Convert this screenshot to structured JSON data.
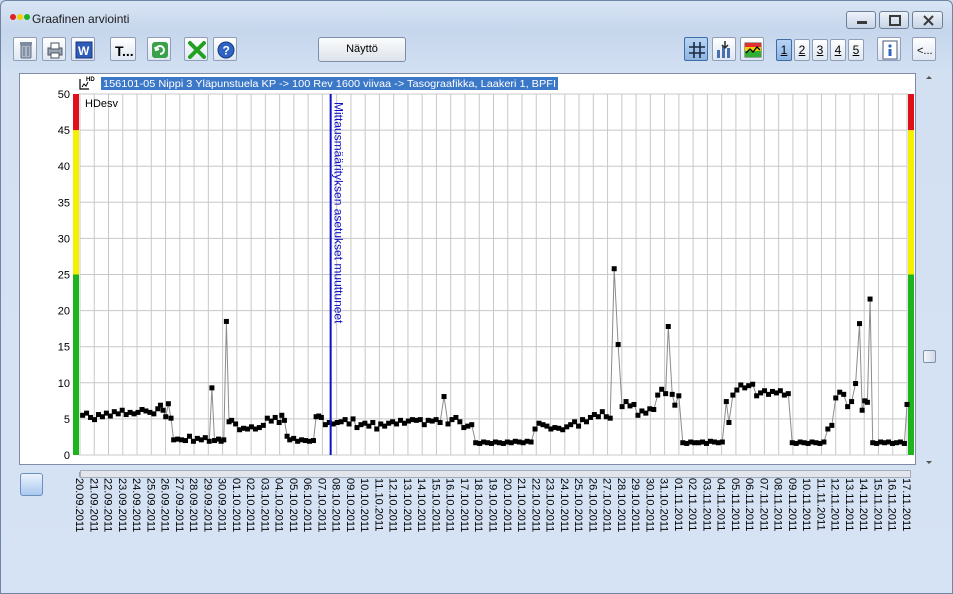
{
  "window": {
    "title": "Graafinen arviointi"
  },
  "toolbar": {
    "naytto_label": "Näyttö",
    "text_tool_label": "T...",
    "left_buttons": [
      "trash-icon",
      "printer-icon",
      "word-export-icon",
      "text-tool-icon",
      "refresh-icon",
      "cancel-icon",
      "help-icon"
    ],
    "right_buttons": [
      "grid-icon",
      "chart-export-icon",
      "chart-view-icon"
    ],
    "page_numbers": [
      "1",
      "2",
      "3",
      "4",
      "5"
    ],
    "selected_page": "1",
    "back_label": "<..."
  },
  "plot": {
    "header_label": "156101-05 Nippi 3 Yläpunstuela KP -> 100 Rev 1600 viivaa -> Tasograafikka, Laakeri 1, BPFI",
    "hd_badge": "HD",
    "series_label": "HDesv",
    "annotation_text": "Mittausmäärityksen asetukset muuttuneet",
    "colors": {
      "line": "#8c8c8c",
      "marker": "#000000",
      "annotation": "#1010c8",
      "zone_green": "#1db41d",
      "zone_yellow": "#f4f000",
      "zone_red": "#e0101a",
      "header_bg": "#3c78c8"
    }
  },
  "chart_data": {
    "type": "scatter",
    "ylim": [
      0,
      50
    ],
    "yticks": [
      0,
      5,
      10,
      15,
      20,
      25,
      30,
      35,
      40,
      45,
      50
    ],
    "grid": true,
    "zones": [
      {
        "from": 0,
        "to": 25,
        "color": "green"
      },
      {
        "from": 25,
        "to": 45,
        "color": "yellow"
      },
      {
        "from": 45,
        "to": 50,
        "color": "red"
      }
    ],
    "x_range_days": [
      0,
      57
    ],
    "annotation_day": 18,
    "xtick_labels": [
      "20.09.2011",
      "21.09.2011",
      "22.09.2011",
      "23.09.2011",
      "24.09.2011",
      "25.09.2011",
      "26.09.2011",
      "27.09.2011",
      "28.09.2011",
      "29.09.2011",
      "30.09.2011",
      "01.10.2011",
      "02.10.2011",
      "03.10.2011",
      "04.10.2011",
      "05.10.2011",
      "06.10.2011",
      "07.10.2011",
      "08.10.2011",
      "09.10.2011",
      "10.10.2011",
      "11.10.2011",
      "12.10.2011",
      "13.10.2011",
      "14.10.2011",
      "15.10.2011",
      "16.10.2011",
      "17.10.2011",
      "18.10.2011",
      "19.10.2011",
      "20.10.2011",
      "21.10.2011",
      "22.10.2011",
      "23.10.2011",
      "24.10.2011",
      "25.10.2011",
      "26.10.2011",
      "27.10.2011",
      "28.10.2011",
      "29.10.2011",
      "30.10.2011",
      "31.10.2011",
      "01.11.2011",
      "02.11.2011",
      "03.11.2011",
      "04.11.2011",
      "05.11.2011",
      "06.11.2011",
      "07.11.2011",
      "08.11.2011",
      "09.11.2011",
      "10.11.2011",
      "11.11.2011",
      "12.11.2011",
      "13.11.2011",
      "14.11.2011",
      "15.11.2011",
      "16.11.2011",
      "17.11.2011"
    ],
    "points": [
      [
        0.2,
        5.5
      ],
      [
        0.5,
        5.8
      ],
      [
        0.8,
        5.2
      ],
      [
        1.1,
        4.9
      ],
      [
        1.4,
        5.6
      ],
      [
        1.7,
        5.3
      ],
      [
        2.0,
        5.8
      ],
      [
        2.3,
        5.4
      ],
      [
        2.6,
        6.0
      ],
      [
        2.9,
        5.7
      ],
      [
        3.2,
        6.2
      ],
      [
        3.5,
        5.6
      ],
      [
        3.8,
        5.9
      ],
      [
        4.1,
        5.7
      ],
      [
        4.4,
        5.9
      ],
      [
        4.7,
        6.3
      ],
      [
        5.0,
        6.1
      ],
      [
        5.3,
        5.9
      ],
      [
        5.6,
        5.7
      ],
      [
        5.9,
        6.4
      ],
      [
        6.1,
        6.9
      ],
      [
        6.3,
        6.2
      ],
      [
        6.5,
        5.3
      ],
      [
        6.7,
        7.1
      ],
      [
        6.9,
        5.1
      ],
      [
        7.1,
        2.1
      ],
      [
        7.4,
        2.2
      ],
      [
        7.7,
        2.1
      ],
      [
        8.0,
        2.0
      ],
      [
        8.3,
        2.6
      ],
      [
        8.6,
        1.9
      ],
      [
        8.9,
        2.3
      ],
      [
        9.2,
        2.1
      ],
      [
        9.5,
        2.4
      ],
      [
        9.8,
        1.9
      ],
      [
        10.0,
        9.3
      ],
      [
        10.2,
        2.0
      ],
      [
        10.5,
        2.2
      ],
      [
        10.7,
        1.9
      ],
      [
        10.9,
        2.1
      ],
      [
        11.1,
        18.5
      ],
      [
        11.3,
        4.6
      ],
      [
        11.5,
        4.8
      ],
      [
        11.8,
        4.3
      ],
      [
        12.1,
        3.5
      ],
      [
        12.4,
        3.7
      ],
      [
        12.7,
        3.6
      ],
      [
        13.0,
        3.9
      ],
      [
        13.3,
        3.6
      ],
      [
        13.6,
        3.8
      ],
      [
        13.9,
        4.1
      ],
      [
        14.2,
        5.1
      ],
      [
        14.5,
        4.7
      ],
      [
        14.8,
        5.2
      ],
      [
        15.1,
        4.5
      ],
      [
        15.3,
        5.5
      ],
      [
        15.5,
        4.8
      ],
      [
        15.7,
        2.6
      ],
      [
        15.9,
        2.1
      ],
      [
        16.2,
        2.3
      ],
      [
        16.5,
        1.9
      ],
      [
        16.8,
        2.1
      ],
      [
        17.1,
        2.0
      ],
      [
        17.4,
        1.9
      ],
      [
        17.7,
        2.0
      ],
      [
        17.9,
        5.3
      ],
      [
        18.1,
        5.4
      ],
      [
        18.3,
        5.2
      ],
      [
        18.6,
        4.2
      ],
      [
        18.9,
        4.5
      ],
      [
        19.2,
        4.3
      ],
      [
        19.5,
        4.5
      ],
      [
        19.8,
        4.6
      ],
      [
        20.1,
        4.9
      ],
      [
        20.4,
        4.3
      ],
      [
        20.7,
        5.0
      ],
      [
        21.0,
        3.8
      ],
      [
        21.3,
        4.2
      ],
      [
        21.6,
        4.4
      ],
      [
        21.9,
        4.0
      ],
      [
        22.2,
        4.5
      ],
      [
        22.5,
        3.6
      ],
      [
        22.8,
        4.3
      ],
      [
        23.1,
        4.0
      ],
      [
        23.4,
        4.4
      ],
      [
        23.7,
        4.6
      ],
      [
        24.0,
        4.3
      ],
      [
        24.3,
        4.8
      ],
      [
        24.6,
        4.4
      ],
      [
        24.9,
        4.7
      ],
      [
        25.2,
        4.9
      ],
      [
        25.5,
        4.8
      ],
      [
        25.8,
        4.9
      ],
      [
        26.1,
        4.2
      ],
      [
        26.4,
        4.8
      ],
      [
        26.7,
        4.7
      ],
      [
        27.0,
        4.9
      ],
      [
        27.3,
        4.5
      ],
      [
        27.6,
        8.1
      ],
      [
        27.9,
        4.3
      ],
      [
        28.2,
        4.9
      ],
      [
        28.5,
        5.2
      ],
      [
        28.8,
        4.6
      ],
      [
        29.1,
        3.8
      ],
      [
        29.4,
        4.0
      ],
      [
        29.7,
        4.2
      ],
      [
        30.0,
        1.7
      ],
      [
        30.3,
        1.6
      ],
      [
        30.6,
        1.8
      ],
      [
        30.9,
        1.7
      ],
      [
        31.2,
        1.6
      ],
      [
        31.5,
        1.8
      ],
      [
        31.8,
        1.7
      ],
      [
        32.1,
        1.6
      ],
      [
        32.4,
        1.8
      ],
      [
        32.7,
        1.7
      ],
      [
        33.0,
        1.9
      ],
      [
        33.3,
        1.8
      ],
      [
        33.6,
        1.7
      ],
      [
        33.9,
        1.9
      ],
      [
        34.2,
        1.8
      ],
      [
        34.5,
        3.6
      ],
      [
        34.8,
        4.4
      ],
      [
        35.1,
        4.2
      ],
      [
        35.4,
        4.0
      ],
      [
        35.7,
        3.6
      ],
      [
        36.0,
        3.8
      ],
      [
        36.3,
        3.7
      ],
      [
        36.6,
        3.5
      ],
      [
        36.9,
        3.9
      ],
      [
        37.2,
        4.2
      ],
      [
        37.5,
        4.6
      ],
      [
        37.8,
        4.0
      ],
      [
        38.1,
        4.9
      ],
      [
        38.4,
        4.6
      ],
      [
        38.7,
        5.2
      ],
      [
        39.0,
        5.6
      ],
      [
        39.3,
        5.3
      ],
      [
        39.6,
        6.0
      ],
      [
        39.9,
        5.3
      ],
      [
        40.2,
        5.1
      ],
      [
        40.5,
        25.8
      ],
      [
        40.8,
        15.3
      ],
      [
        41.1,
        6.7
      ],
      [
        41.4,
        7.4
      ],
      [
        41.7,
        6.8
      ],
      [
        42.0,
        7.0
      ],
      [
        42.3,
        5.5
      ],
      [
        42.6,
        6.1
      ],
      [
        42.9,
        5.8
      ],
      [
        43.2,
        6.4
      ],
      [
        43.5,
        6.3
      ],
      [
        43.8,
        8.3
      ],
      [
        44.1,
        9.1
      ],
      [
        44.4,
        8.5
      ],
      [
        44.6,
        17.8
      ],
      [
        44.9,
        8.4
      ],
      [
        45.1,
        6.9
      ],
      [
        45.4,
        8.2
      ],
      [
        45.7,
        1.7
      ],
      [
        46.0,
        1.6
      ],
      [
        46.3,
        1.8
      ],
      [
        46.6,
        1.7
      ],
      [
        46.9,
        1.7
      ],
      [
        47.2,
        1.8
      ],
      [
        47.5,
        1.6
      ],
      [
        47.8,
        1.9
      ],
      [
        48.1,
        1.8
      ],
      [
        48.4,
        1.7
      ],
      [
        48.7,
        1.8
      ],
      [
        49.0,
        7.4
      ],
      [
        49.2,
        4.5
      ],
      [
        49.5,
        8.3
      ],
      [
        49.8,
        9.0
      ],
      [
        50.1,
        9.7
      ],
      [
        50.4,
        9.3
      ],
      [
        50.7,
        9.6
      ],
      [
        51.0,
        9.8
      ],
      [
        51.3,
        8.2
      ],
      [
        51.6,
        8.6
      ],
      [
        51.9,
        8.9
      ],
      [
        52.2,
        8.4
      ],
      [
        52.5,
        8.8
      ],
      [
        52.8,
        8.6
      ],
      [
        53.1,
        8.9
      ],
      [
        53.4,
        8.3
      ],
      [
        53.7,
        8.5
      ],
      [
        54.0,
        1.7
      ],
      [
        54.3,
        1.6
      ],
      [
        54.6,
        1.8
      ],
      [
        54.9,
        1.7
      ],
      [
        55.2,
        1.6
      ],
      [
        55.5,
        1.8
      ],
      [
        55.8,
        1.7
      ],
      [
        56.1,
        1.6
      ],
      [
        56.4,
        1.8
      ],
      [
        56.7,
        3.6
      ]
    ],
    "points_tail": [
      [
        57.0,
        4.1
      ],
      [
        57.3,
        7.9
      ],
      [
        57.6,
        8.7
      ],
      [
        57.9,
        8.4
      ],
      [
        58.2,
        6.7
      ],
      [
        58.5,
        7.4
      ],
      [
        58.8,
        9.9
      ],
      [
        59.1,
        18.2
      ],
      [
        59.3,
        6.2
      ],
      [
        59.5,
        7.5
      ],
      [
        59.7,
        7.3
      ],
      [
        59.9,
        21.6
      ],
      [
        60.1,
        1.7
      ],
      [
        60.4,
        1.6
      ],
      [
        60.7,
        1.8
      ],
      [
        61.0,
        1.7
      ],
      [
        61.3,
        1.8
      ],
      [
        61.6,
        1.6
      ],
      [
        61.9,
        1.7
      ],
      [
        62.2,
        1.8
      ],
      [
        62.5,
        1.6
      ],
      [
        62.7,
        7.0
      ]
    ]
  }
}
